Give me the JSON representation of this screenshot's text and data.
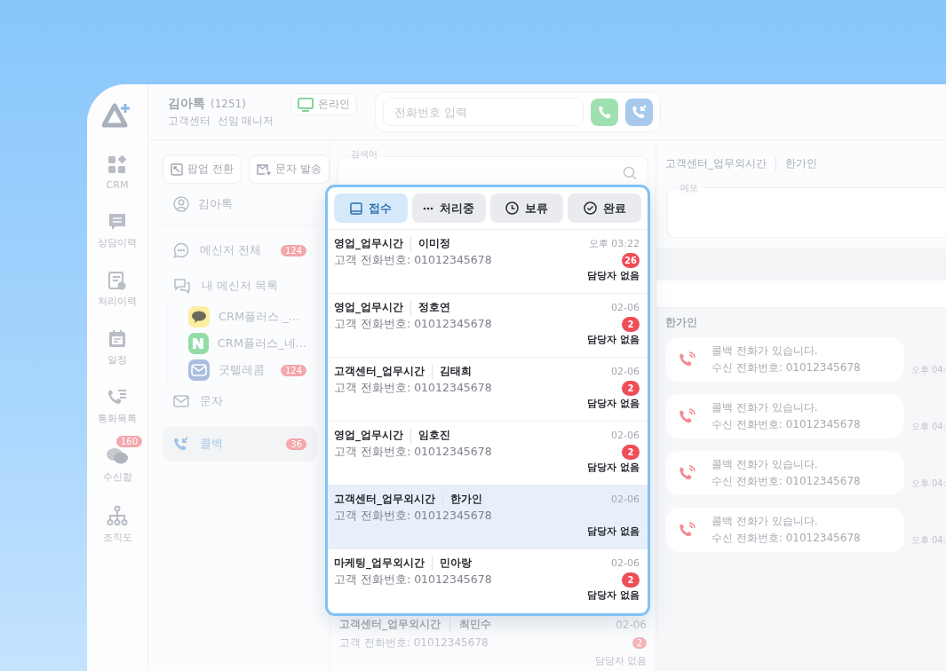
{
  "rail": {
    "items": [
      {
        "kind": "crm",
        "label": "CRM"
      },
      {
        "kind": "consult",
        "label": "상담이력"
      },
      {
        "kind": "process",
        "label": "처리이력"
      },
      {
        "kind": "schedule",
        "label": "일정"
      },
      {
        "kind": "calls",
        "label": "통화목록"
      },
      {
        "kind": "inbox",
        "label": "수신함",
        "badge": "160"
      },
      {
        "kind": "org",
        "label": "조직도"
      }
    ]
  },
  "header": {
    "user_name": "김아톡",
    "user_ext": "(1251)",
    "user_role": "고객센터  선임 매니저",
    "status": "온라인",
    "phone_field": {
      "placeholder": "전화번호 입력"
    }
  },
  "left_panel": {
    "buttons": [
      {
        "kind": "popup",
        "label": "팝업 전환"
      },
      {
        "kind": "sms",
        "label": "문자 발송"
      }
    ],
    "user": "김아톡",
    "menu": [
      {
        "kind": "messenger",
        "label": "메신저 전체",
        "badge": "124",
        "selected": false
      },
      {
        "kind": "my-messenger",
        "label": "내 메신저 목록",
        "selected": false,
        "children": [
          {
            "kind": "talk",
            "label": "CRM플러스 _..."
          },
          {
            "kind": "naver",
            "label": "CRM플러스_네..."
          },
          {
            "kind": "mail",
            "label": "굿텔레콤",
            "badge": "124"
          }
        ]
      },
      {
        "kind": "sms",
        "label": "문자",
        "selected": false
      },
      {
        "kind": "callback",
        "label": "콜백",
        "badge": "36",
        "selected": true
      }
    ]
  },
  "list": {
    "search_field": {
      "label": "검색어"
    },
    "behind_row": {
      "group": "고객센터_업무외시간",
      "name": "최민수",
      "time": "02-06",
      "phone": "고객 전화번호: 01012345678",
      "badge": "2",
      "assignee": "담당자 없음"
    }
  },
  "popup": {
    "tabs": [
      {
        "kind": "received",
        "label": "접수",
        "selected": true
      },
      {
        "kind": "processing",
        "label": "처리중",
        "selected": false
      },
      {
        "kind": "hold",
        "label": "보류",
        "selected": false
      },
      {
        "kind": "done",
        "label": "완료",
        "selected": false
      }
    ],
    "rows": [
      {
        "group": "영업_업무시간",
        "name": "이미정",
        "time": "오후 03:22",
        "phone": "고객 전화번호: 01012345678",
        "badge": "26",
        "assignee": "담당자 없음",
        "selected": false
      },
      {
        "group": "영업_업무시간",
        "name": "정호연",
        "time": "02-06",
        "phone": "고객 전화번호: 01012345678",
        "badge": "2",
        "assignee": "담당자 없음",
        "selected": false
      },
      {
        "group": "고객센터_업무시간",
        "name": "김태희",
        "time": "02-06",
        "phone": "고객 전화번호: 01012345678",
        "badge": "2",
        "assignee": "담당자 없음",
        "selected": false
      },
      {
        "group": "영업_업무시간",
        "name": "임호진",
        "time": "02-06",
        "phone": "고객 전화번호: 01012345678",
        "badge": "2",
        "assignee": "담당자 없음",
        "selected": false
      },
      {
        "group": "고객센터_업무외시간",
        "name": "한가인",
        "time": "02-06",
        "phone": "고객 전화번호: 01012345678",
        "assignee": "담당자 없음",
        "selected": true
      },
      {
        "group": "마케팅_업무외시간",
        "name": "민아랑",
        "time": "02-06",
        "phone": "고객 전화번호: 01012345678",
        "badge": "2",
        "assignee": "담당자 없음",
        "selected": false
      }
    ]
  },
  "detail": {
    "group": "고객센터_업무외시간",
    "name": "한가인",
    "memo_field": {
      "label": "메모"
    },
    "section": "한가인",
    "messages": [
      {
        "title": "콜백 전화가 있습니다.",
        "phone": "수신 전화번호: 01012345678",
        "time": "오후 04:"
      },
      {
        "title": "콜백 전화가 있습니다.",
        "phone": "수신 전화번호: 01012345678",
        "time": "오후 04:"
      },
      {
        "title": "콜백 전화가 있습니다.",
        "phone": "수신 전화번호: 01012345678",
        "time": "오후 04:"
      },
      {
        "title": "콜백 전화가 있습니다.",
        "phone": "수신 전화번호: 01012345678",
        "time": "오후 04:"
      }
    ]
  }
}
